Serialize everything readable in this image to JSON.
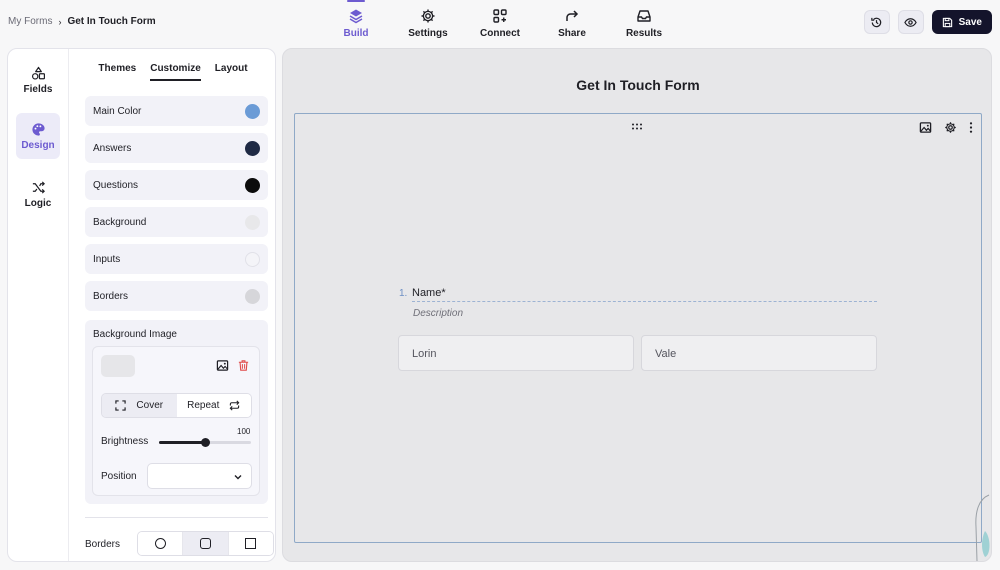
{
  "breadcrumb": {
    "root": "My Forms",
    "current": "Get In Touch Form"
  },
  "nav": {
    "tabs": [
      {
        "label": "Build",
        "icon": "layers-icon",
        "active": true
      },
      {
        "label": "Settings",
        "icon": "gear-icon"
      },
      {
        "label": "Connect",
        "icon": "grid-plus-icon"
      },
      {
        "label": "Share",
        "icon": "share-arrow-icon"
      },
      {
        "label": "Results",
        "icon": "inbox-icon"
      }
    ]
  },
  "top_actions": {
    "history_icon": "history-icon",
    "preview_icon": "eye-icon",
    "save_label": "Save"
  },
  "rail": {
    "items": [
      {
        "label": "Fields",
        "icon": "shapes-icon"
      },
      {
        "label": "Design",
        "icon": "palette-icon",
        "active": true
      },
      {
        "label": "Logic",
        "icon": "shuffle-icon"
      }
    ]
  },
  "subtabs": {
    "themes": "Themes",
    "customize": "Customize",
    "layout": "Layout",
    "active": "Customize"
  },
  "colors": [
    {
      "label": "Main Color",
      "color": "#6b9bd6"
    },
    {
      "label": "Answers",
      "color": "#1f2a44"
    },
    {
      "label": "Questions",
      "color": "#0c0c0c"
    },
    {
      "label": "Background",
      "color": "#e8e8ea"
    },
    {
      "label": "Inputs",
      "color": "#f4f4f8"
    },
    {
      "label": "Borders",
      "color": "#d6d6da"
    }
  ],
  "background_image": {
    "title": "Background Image",
    "cover_label": "Cover",
    "repeat_label": "Repeat",
    "brightness_label": "Brightness",
    "brightness_value": "100",
    "brightness_fraction": 0.5,
    "position_label": "Position",
    "position_value": ""
  },
  "borders": {
    "label": "Borders",
    "options": [
      "round",
      "rounded",
      "square"
    ],
    "active": "rounded"
  },
  "canvas": {
    "form_title": "Get In Touch Form",
    "question": {
      "number": "1.",
      "title": "Name*",
      "description": "Description",
      "first_placeholder": "Lorin",
      "last_placeholder": "Vale"
    }
  }
}
